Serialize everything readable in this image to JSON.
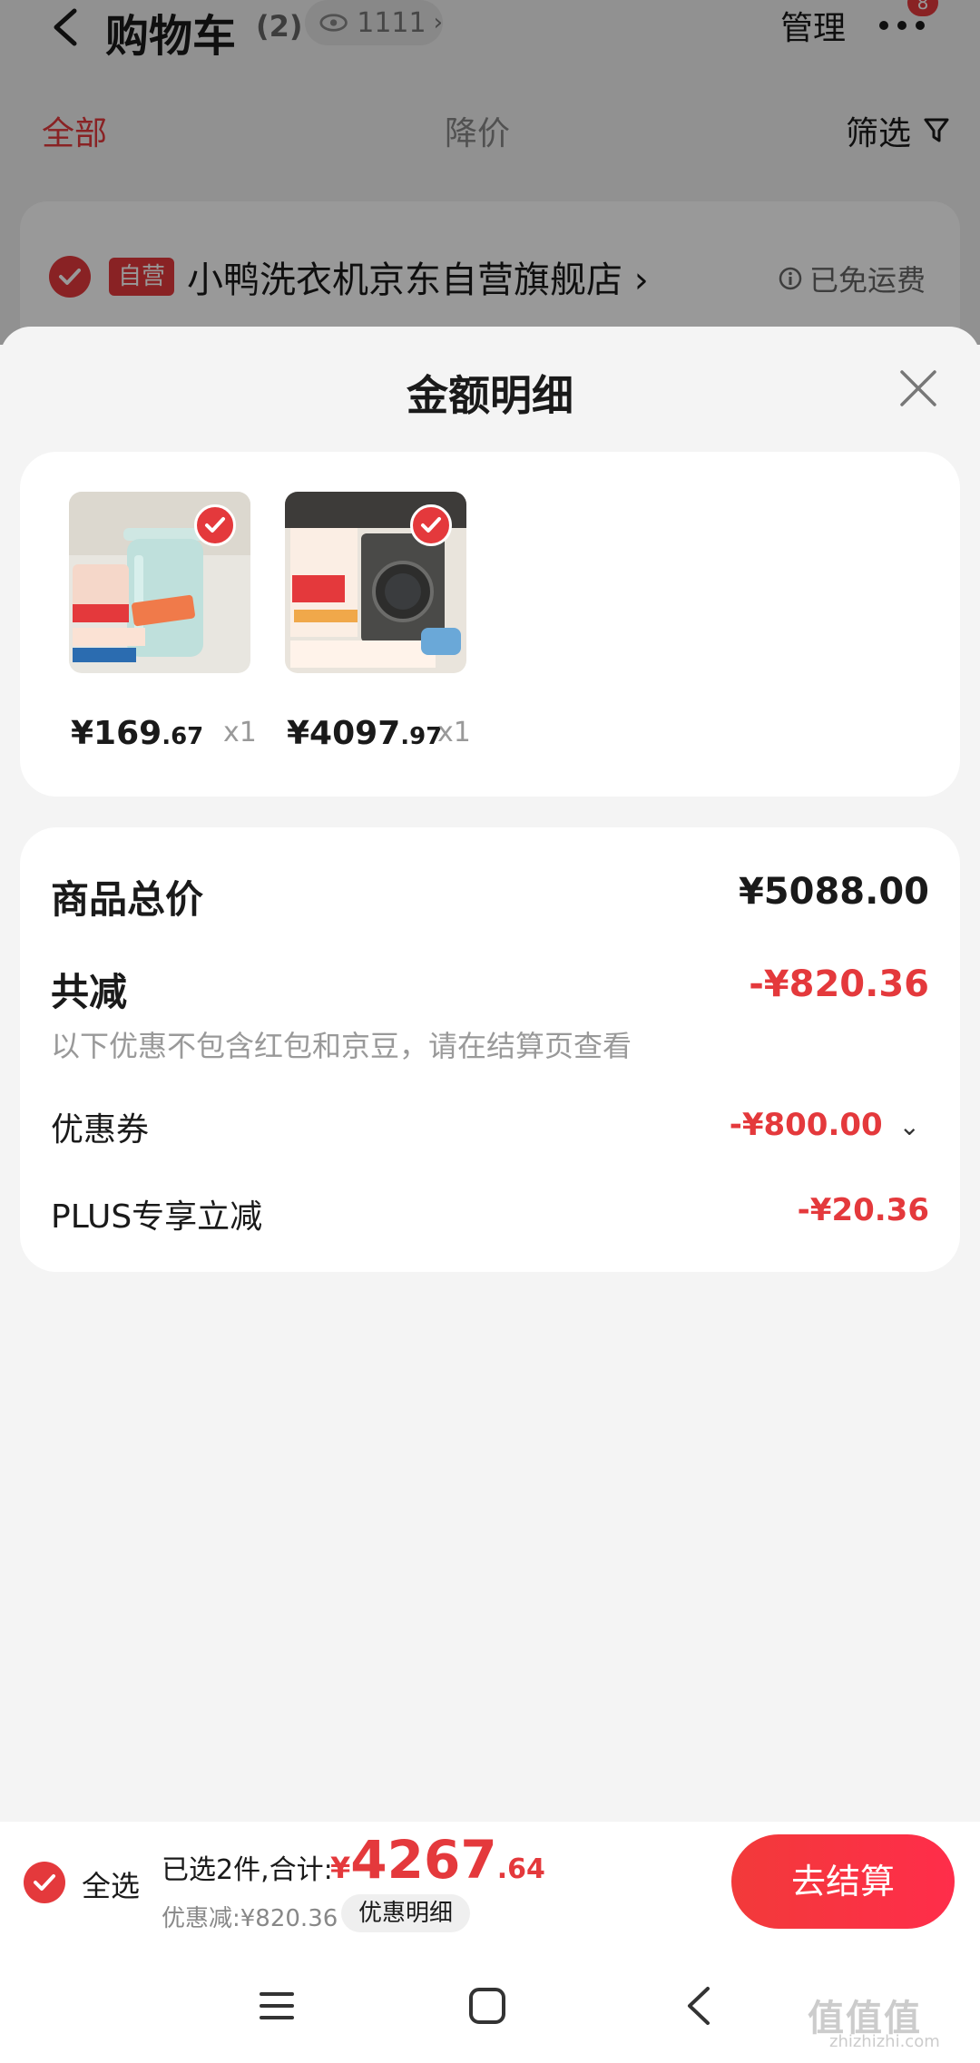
{
  "header": {
    "title": "购物车",
    "count": "(2)",
    "views": "1111",
    "manage_label": "管理",
    "badge": "8"
  },
  "tabs": {
    "all": "全部",
    "price_drop": "降价",
    "filter": "筛选"
  },
  "store": {
    "tag": "自营",
    "name": "小鸭洗衣机京东自营旗舰店",
    "shipping": "已免运费"
  },
  "sheet": {
    "title": "金额明细",
    "products": [
      {
        "price_int": "¥169",
        "price_dec": ".67",
        "qty": "x1"
      },
      {
        "price_int": "¥4097",
        "price_dec": ".97",
        "qty": "x1"
      }
    ],
    "goods_total_label": "商品总价",
    "goods_total_value": "¥5088.00",
    "discount_label": "共减",
    "discount_value": "-¥820.36",
    "hint": "以下优惠不包含红包和京豆，请在结算页查看",
    "coupon_label": "优惠券",
    "coupon_value": "-¥800.00",
    "plus_label": "PLUS专享立减",
    "plus_value": "-¥20.36"
  },
  "checkout": {
    "select_all": "全选",
    "summary": "已选2件,合计:",
    "total_cur": "¥",
    "total_int": "4267",
    "total_dec": ".64",
    "discount_line": "优惠减:¥820.36",
    "detail_pill": "优惠明细",
    "button": "去结算"
  },
  "watermark": {
    "main": "值值值",
    "sub": "zhizhizhi.com"
  },
  "colors": {
    "accent": "#e4393c",
    "background": "#f4f4f4"
  }
}
